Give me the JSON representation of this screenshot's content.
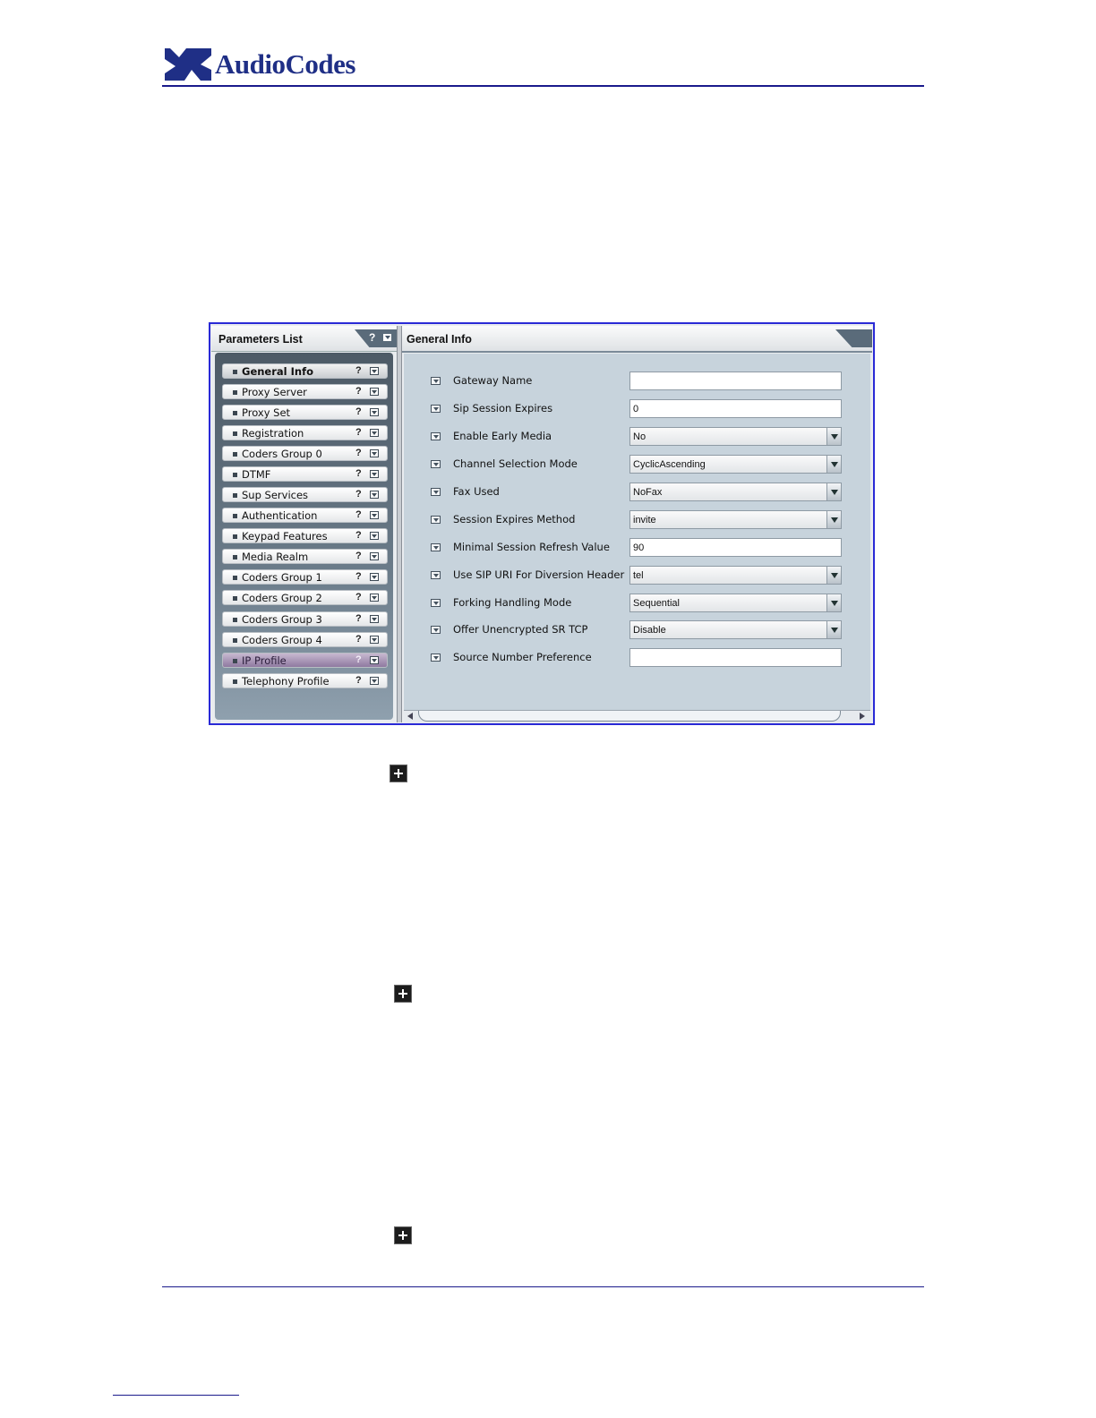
{
  "header": {
    "logo_text": "AudioCodes",
    "brand_color": "#1f2f86"
  },
  "left_panel": {
    "title": "Parameters List",
    "help_glyph": "?",
    "items": [
      {
        "label": "General Info",
        "state": "selected"
      },
      {
        "label": "Proxy Server"
      },
      {
        "label": "Proxy Set"
      },
      {
        "label": "Registration"
      },
      {
        "label": "Coders Group 0"
      },
      {
        "label": "DTMF"
      },
      {
        "label": "Sup Services"
      },
      {
        "label": "Authentication"
      },
      {
        "label": "Keypad Features"
      },
      {
        "label": "Media Realm"
      },
      {
        "label": "Coders Group 1"
      },
      {
        "label": "Coders Group 2"
      },
      {
        "label": "Coders Group 3"
      },
      {
        "label": "Coders Group 4"
      },
      {
        "label": "IP Profile",
        "state": "highlighted"
      },
      {
        "label": "Telephony Profile"
      }
    ],
    "item_help": "?"
  },
  "right_panel": {
    "title": "General Info",
    "params": [
      {
        "label": "Gateway Name",
        "type": "text",
        "value": ""
      },
      {
        "label": "Sip Session Expires",
        "type": "text",
        "value": "0"
      },
      {
        "label": "Enable Early Media",
        "type": "select",
        "value": "No"
      },
      {
        "label": "Channel Selection Mode",
        "type": "select",
        "value": "CyclicAscending"
      },
      {
        "label": "Fax Used",
        "type": "select",
        "value": "NoFax"
      },
      {
        "label": "Session Expires Method",
        "type": "select",
        "value": "invite"
      },
      {
        "label": "Minimal Session Refresh Value",
        "type": "text",
        "value": "90"
      },
      {
        "label": "Use SIP URI For Diversion Header",
        "type": "select",
        "value": "tel"
      },
      {
        "label": "Forking Handling Mode",
        "type": "select",
        "value": "Sequential"
      },
      {
        "label": "Offer Unencrypted SR TCP",
        "type": "select",
        "value": "Disable"
      },
      {
        "label": "Source Number Preference",
        "type": "text",
        "value": ""
      }
    ]
  },
  "icons": {
    "expand": "plus-box-icon",
    "dropdown": "chevron-down-icon",
    "help": "question-icon"
  }
}
